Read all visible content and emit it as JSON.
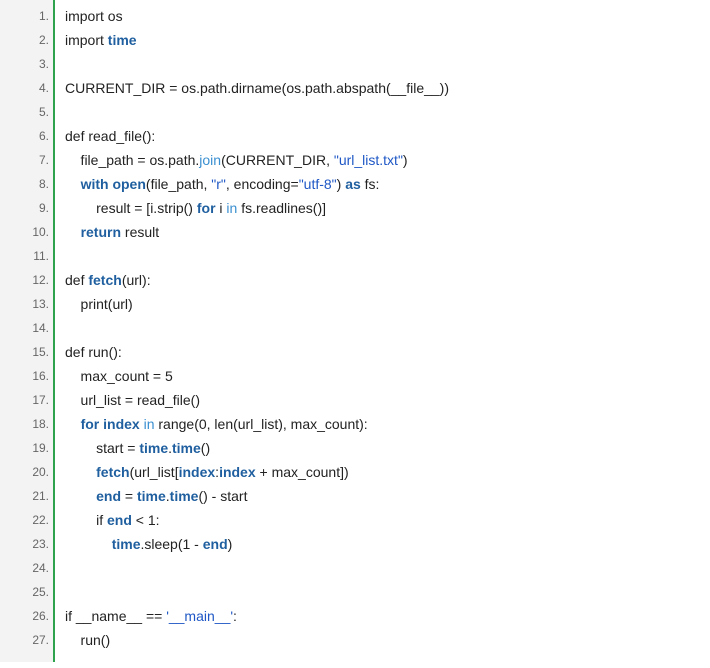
{
  "code": {
    "lines": [
      {
        "n": "1.",
        "tokens": [
          {
            "t": "import os",
            "c": "plain"
          }
        ]
      },
      {
        "n": "2.",
        "tokens": [
          {
            "t": "import ",
            "c": "plain"
          },
          {
            "t": "time",
            "c": "kw"
          }
        ]
      },
      {
        "n": "3.",
        "tokens": []
      },
      {
        "n": "4.",
        "tokens": [
          {
            "t": "CURRENT_DIR = os.path.dirname(os.path.abspath(__file__))",
            "c": "plain"
          }
        ]
      },
      {
        "n": "5.",
        "tokens": []
      },
      {
        "n": "6.",
        "tokens": [
          {
            "t": "def read_file():",
            "c": "plain"
          }
        ]
      },
      {
        "n": "7.",
        "tokens": [
          {
            "t": "    file_path = os.path.",
            "c": "plain"
          },
          {
            "t": "join",
            "c": "builtin"
          },
          {
            "t": "(CURRENT_DIR, ",
            "c": "plain"
          },
          {
            "t": "\"url_list.txt\"",
            "c": "str"
          },
          {
            "t": ")",
            "c": "plain"
          }
        ]
      },
      {
        "n": "8.",
        "tokens": [
          {
            "t": "    ",
            "c": "plain"
          },
          {
            "t": "with",
            "c": "kw"
          },
          {
            "t": " ",
            "c": "plain"
          },
          {
            "t": "open",
            "c": "kw"
          },
          {
            "t": "(file_path, ",
            "c": "plain"
          },
          {
            "t": "\"r\"",
            "c": "str"
          },
          {
            "t": ", encoding=",
            "c": "plain"
          },
          {
            "t": "\"utf-8\"",
            "c": "str"
          },
          {
            "t": ") ",
            "c": "plain"
          },
          {
            "t": "as",
            "c": "kw"
          },
          {
            "t": " fs:",
            "c": "plain"
          }
        ]
      },
      {
        "n": "9.",
        "tokens": [
          {
            "t": "        result = [i.strip() ",
            "c": "plain"
          },
          {
            "t": "for",
            "c": "kw"
          },
          {
            "t": " i ",
            "c": "plain"
          },
          {
            "t": "in",
            "c": "builtin"
          },
          {
            "t": " fs.readlines()]",
            "c": "plain"
          }
        ]
      },
      {
        "n": "10.",
        "tokens": [
          {
            "t": "    ",
            "c": "plain"
          },
          {
            "t": "return",
            "c": "kw"
          },
          {
            "t": " result",
            "c": "plain"
          }
        ]
      },
      {
        "n": "11.",
        "tokens": []
      },
      {
        "n": "12.",
        "tokens": [
          {
            "t": "def ",
            "c": "plain"
          },
          {
            "t": "fetch",
            "c": "kw"
          },
          {
            "t": "(url):",
            "c": "plain"
          }
        ]
      },
      {
        "n": "13.",
        "tokens": [
          {
            "t": "    print(url)",
            "c": "plain"
          }
        ]
      },
      {
        "n": "14.",
        "tokens": []
      },
      {
        "n": "15.",
        "tokens": [
          {
            "t": "def run():",
            "c": "plain"
          }
        ]
      },
      {
        "n": "16.",
        "tokens": [
          {
            "t": "    max_count = 5",
            "c": "plain"
          }
        ]
      },
      {
        "n": "17.",
        "tokens": [
          {
            "t": "    url_list = read_file()",
            "c": "plain"
          }
        ]
      },
      {
        "n": "18.",
        "tokens": [
          {
            "t": "    ",
            "c": "plain"
          },
          {
            "t": "for",
            "c": "kw"
          },
          {
            "t": " ",
            "c": "plain"
          },
          {
            "t": "index",
            "c": "kw"
          },
          {
            "t": " ",
            "c": "plain"
          },
          {
            "t": "in",
            "c": "builtin"
          },
          {
            "t": " range(0, len(url_list), max_count):",
            "c": "plain"
          }
        ]
      },
      {
        "n": "19.",
        "tokens": [
          {
            "t": "        start = ",
            "c": "plain"
          },
          {
            "t": "time",
            "c": "kw"
          },
          {
            "t": ".",
            "c": "plain"
          },
          {
            "t": "time",
            "c": "kw"
          },
          {
            "t": "()",
            "c": "plain"
          }
        ]
      },
      {
        "n": "20.",
        "tokens": [
          {
            "t": "        ",
            "c": "plain"
          },
          {
            "t": "fetch",
            "c": "kw"
          },
          {
            "t": "(url_list[",
            "c": "plain"
          },
          {
            "t": "index",
            "c": "kw"
          },
          {
            "t": ":",
            "c": "plain"
          },
          {
            "t": "index",
            "c": "kw"
          },
          {
            "t": " + max_count])",
            "c": "plain"
          }
        ]
      },
      {
        "n": "21.",
        "tokens": [
          {
            "t": "        ",
            "c": "plain"
          },
          {
            "t": "end",
            "c": "kw"
          },
          {
            "t": " = ",
            "c": "plain"
          },
          {
            "t": "time",
            "c": "kw"
          },
          {
            "t": ".",
            "c": "plain"
          },
          {
            "t": "time",
            "c": "kw"
          },
          {
            "t": "() - start",
            "c": "plain"
          }
        ]
      },
      {
        "n": "22.",
        "tokens": [
          {
            "t": "        if ",
            "c": "plain"
          },
          {
            "t": "end",
            "c": "kw"
          },
          {
            "t": " < 1:",
            "c": "plain"
          }
        ]
      },
      {
        "n": "23.",
        "tokens": [
          {
            "t": "            ",
            "c": "plain"
          },
          {
            "t": "time",
            "c": "kw"
          },
          {
            "t": ".sleep(1 - ",
            "c": "plain"
          },
          {
            "t": "end",
            "c": "kw"
          },
          {
            "t": ")",
            "c": "plain"
          }
        ]
      },
      {
        "n": "24.",
        "tokens": []
      },
      {
        "n": "25.",
        "tokens": []
      },
      {
        "n": "26.",
        "tokens": [
          {
            "t": "if __name__ == ",
            "c": "plain"
          },
          {
            "t": "'__main__'",
            "c": "str"
          },
          {
            "t": ":",
            "c": "plain"
          }
        ]
      },
      {
        "n": "27.",
        "tokens": [
          {
            "t": "    run()",
            "c": "plain"
          }
        ]
      }
    ]
  }
}
